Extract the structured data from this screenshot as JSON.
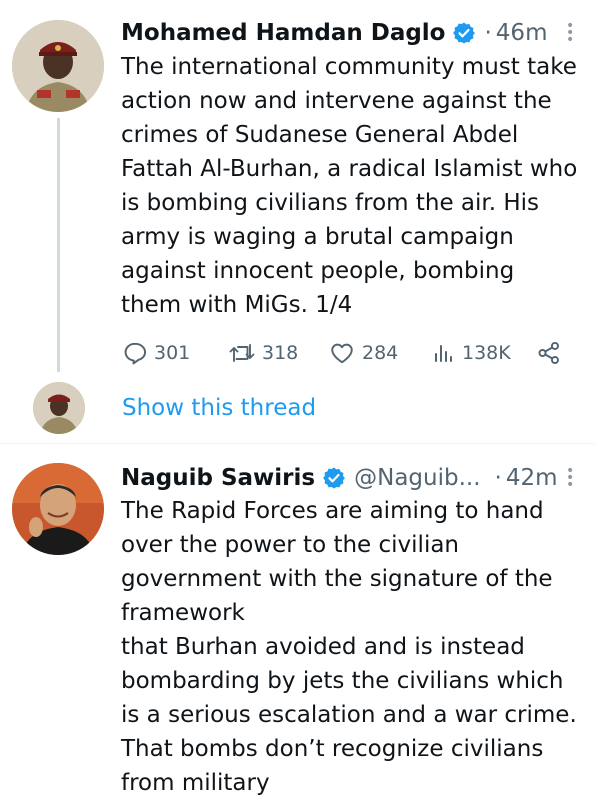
{
  "tweet1": {
    "author": "Mohamed Hamdan Daglo",
    "separator": "·",
    "time": "46m",
    "text": "The international community must take action now and intervene against the crimes of Sudanese General Abdel Fattah Al-Burhan, a radical Islamist who is bombing civilians from the air. His army is waging a brutal campaign against innocent people, bombing them with MiGs. 1/4",
    "replies": "301",
    "retweets": "318",
    "likes": "284",
    "views": "138K",
    "show_thread": "Show this thread",
    "verified_color": "#1d9bf0"
  },
  "tweet2": {
    "author": "Naguib Sawiris",
    "handle": "@Naguib...",
    "separator": "·",
    "time": "42m",
    "text": "The Rapid Forces are aiming to hand over the power to the civilian government with the signature of the framework\nthat Burhan avoided and is instead bombarding by jets the civilians which is a serious escalation and a war crime. That bombs don’t recognize civilians from military",
    "verified_color": "#1d9bf0"
  },
  "icons": {
    "verified": "verified-badge-icon",
    "more": "more-dots-icon",
    "reply": "reply-icon",
    "retweet": "retweet-icon",
    "like": "heart-icon",
    "views": "views-icon",
    "share": "share-icon"
  },
  "colors": {
    "text": "#0f1419",
    "muted": "#536471",
    "link": "#1d9bf0",
    "thread_line": "#cfd9de"
  }
}
